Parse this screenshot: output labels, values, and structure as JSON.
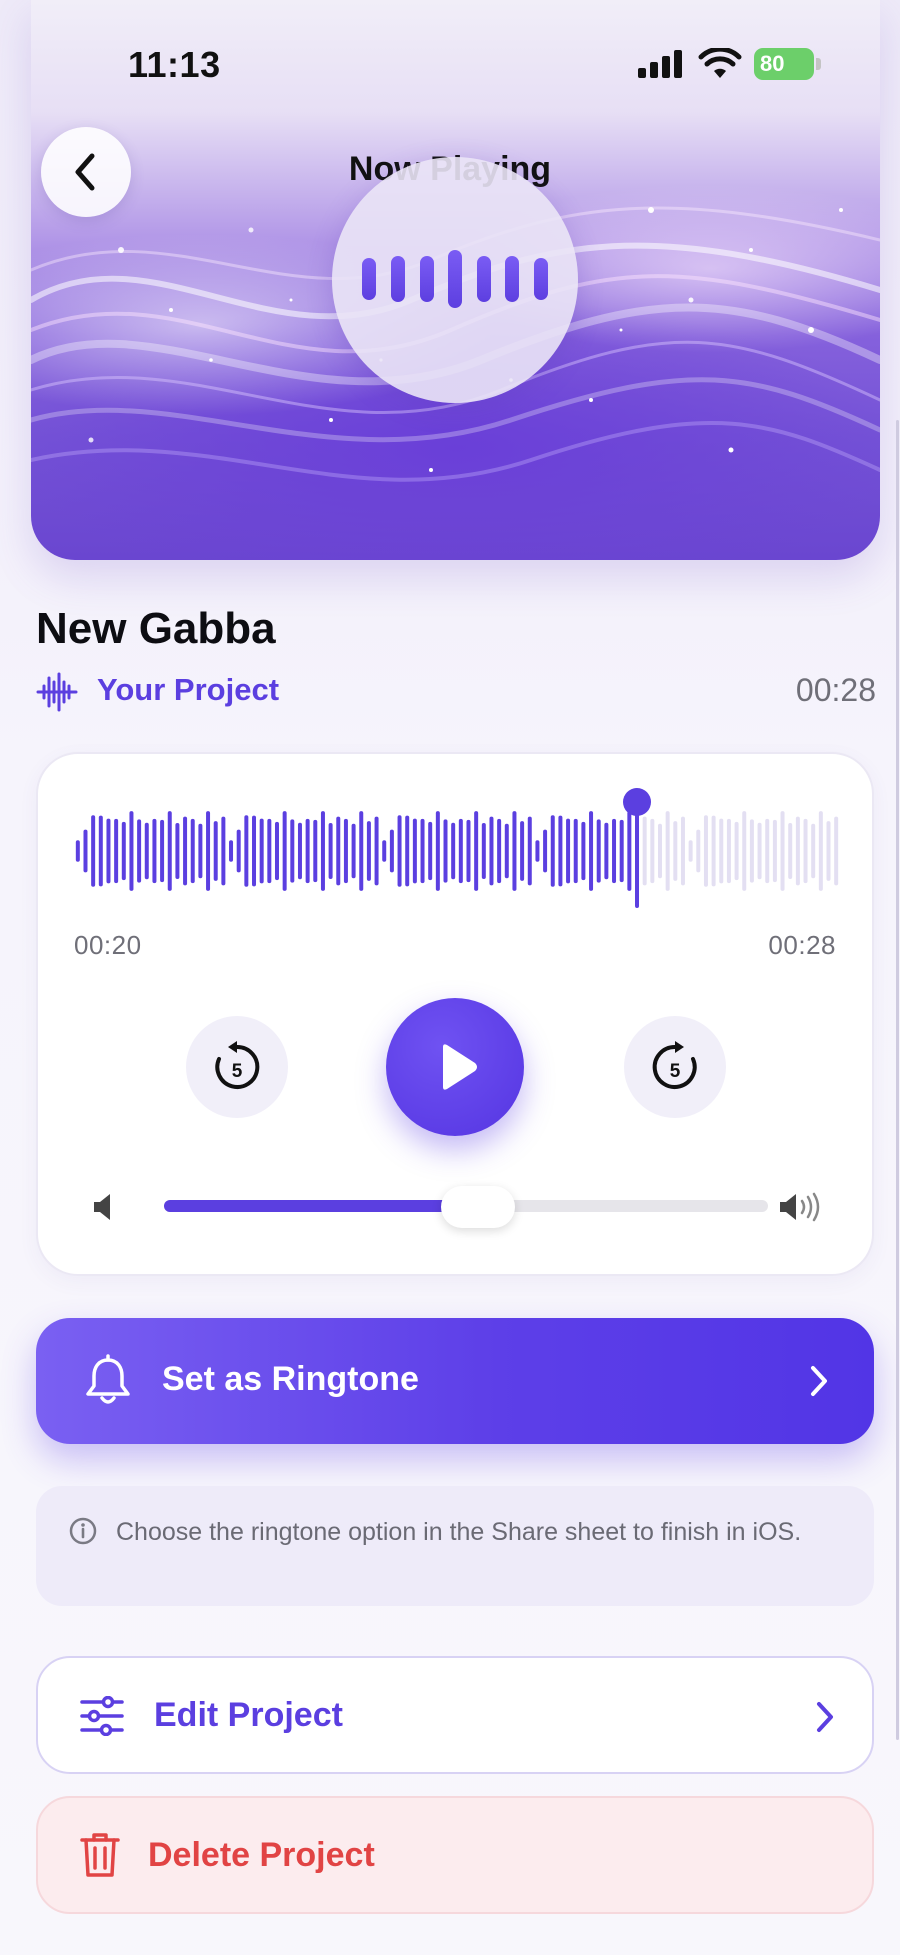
{
  "status_bar": {
    "time": "11:13",
    "battery": "80",
    "icons": [
      "cellular-signal-icon",
      "wifi-icon",
      "battery-charging-icon"
    ]
  },
  "header": {
    "title": "Now Playing",
    "back_icon": "chevron-left-icon",
    "artwork_icon": "equalizer-icon"
  },
  "track": {
    "title": "New Gabba",
    "source_label": "Your Project",
    "source_icon": "waveform-icon",
    "duration": "00:28"
  },
  "player": {
    "current_time": "00:20",
    "end_time": "00:28",
    "progress": 0.735,
    "skip_back_label": "5",
    "skip_forward_label": "5",
    "play_icon": "play-icon",
    "volume": 0.52,
    "volume_low_icon": "speaker-low-icon",
    "volume_high_icon": "speaker-high-icon"
  },
  "actions": {
    "ringtone_label": "Set as Ringtone",
    "ringtone_icon": "bell-icon",
    "info_text": "Choose the ringtone option in the Share sheet to finish in iOS.",
    "info_icon": "info-icon",
    "edit_label": "Edit Project",
    "edit_icon": "sliders-icon",
    "delete_label": "Delete Project",
    "delete_icon": "trash-icon"
  },
  "colors": {
    "accent": "#5B3FE0",
    "danger": "#E14444",
    "battery": "#6CCF6A"
  }
}
